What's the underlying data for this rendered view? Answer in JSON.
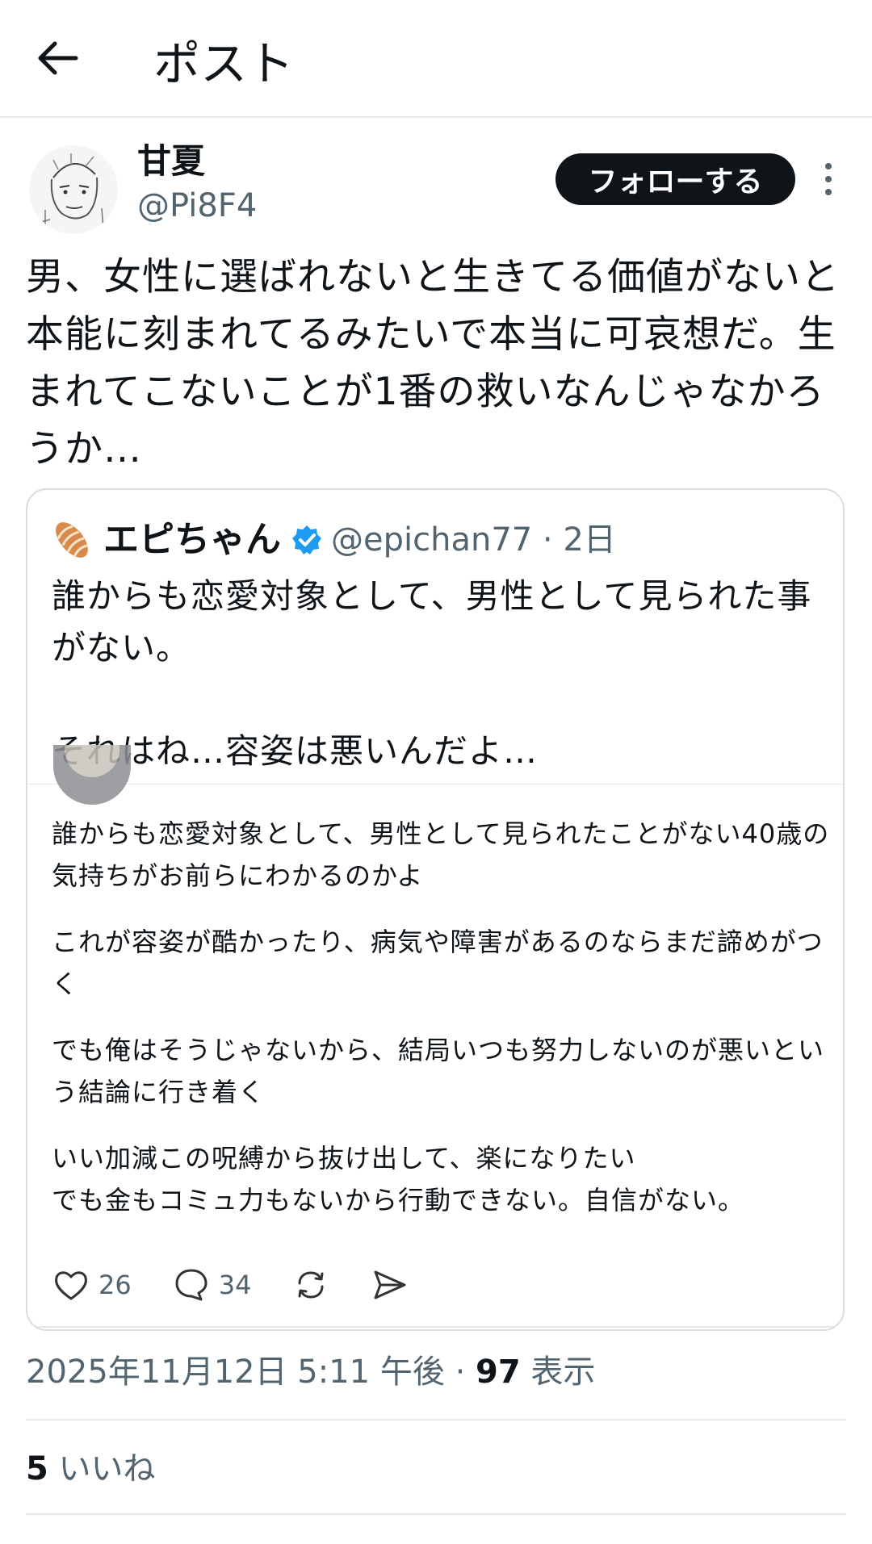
{
  "header": {
    "title": "ポスト"
  },
  "author": {
    "name": "甘夏",
    "handle": "@Pi8F4",
    "follow_label": "フォローする"
  },
  "post": {
    "text": "男、女性に選ばれないと生きてる価値がないと本能に刻まれてるみたいで本当に可哀想だ。生まれてこないことが1番の救いなんじゃなかろうか…"
  },
  "quote": {
    "name": "エピちゃん",
    "handle": "@epichan77",
    "age": "2日",
    "meta_sep": " · ",
    "text_line1": "誰からも恋愛対象として、男性として見られた事がない。",
    "text_line2": "それはね…容姿は悪いんだよ…",
    "screenshot": {
      "p1": "誰からも恋愛対象として、男性として見られたことがない40歳の気持ちがお前らにわかるのかよ",
      "p2": "これが容姿が酷かったり、病気や障害があるのならまだ諦めがつく",
      "p3": "でも俺はそうじゃないから、結局いつも努力しないのが悪いという結論に行き着く",
      "p4a": "いい加減この呪縛から抜け出して、楽になりたい",
      "p4b": "でも金もコミュ力もないから行動できない。自信がない。",
      "likes": "26",
      "replies": "34"
    }
  },
  "timestamp": {
    "datetime": "2025年11月12日 5:11 午後",
    "sep": " · ",
    "views": "97",
    "views_label": " 表示"
  },
  "stats": {
    "likes": "5",
    "likes_label": " いいね"
  },
  "colors": {
    "text": "#0f1419",
    "secondary": "#536471",
    "border": "#e6e9ec",
    "verified": "#1d9bf0"
  }
}
